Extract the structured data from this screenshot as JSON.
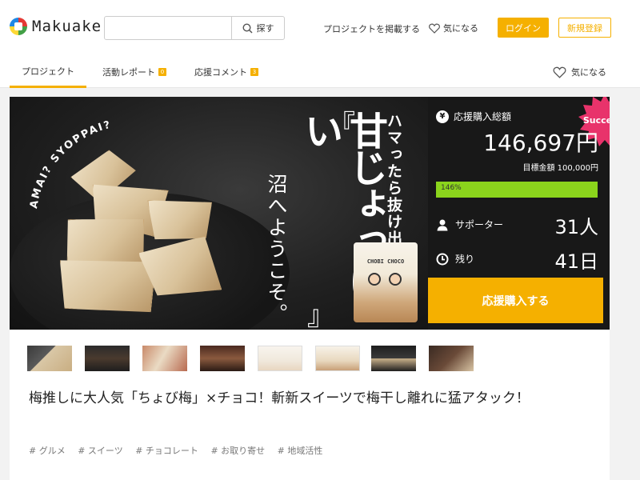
{
  "header": {
    "logo_text": "Makuake",
    "search_placeholder": "",
    "search_button": "探す",
    "post_project": "プロジェクトを掲載する",
    "watchlist": "気になる",
    "login": "ログイン",
    "signup": "新規登録"
  },
  "tabs": {
    "project": "プロジェクト",
    "report": "活動レポート",
    "report_count": "0",
    "comment": "応援コメント",
    "comment_count": "3",
    "watchlist": "気になる"
  },
  "hero": {
    "arc_text": "AMAI? SYOPPAI?",
    "catch_1": "ハマったら抜け出せない。",
    "main_title": "甘じょっぱい",
    "bracket_open": "『",
    "bracket_close": "』",
    "catch_2": "沼へようこそ。",
    "pack_label": "CHOBI CHOCO"
  },
  "stats": {
    "badge": "Success!",
    "total_label": "応援購入総額",
    "total_value": "146,697円",
    "goal": "目標金額 100,000円",
    "progress_percent": 146,
    "progress_label": "146%",
    "supporters_label": "サポーター",
    "supporters_value": "31人",
    "remaining_label": "残り",
    "remaining_value": "41日",
    "buy_button": "応援購入する"
  },
  "colors": {
    "accent": "#f5b000",
    "progress": "#8bd41c",
    "hero_bg": "#181818",
    "success_badge": "#e8336b"
  },
  "project": {
    "title": "梅推しに大人気「ちょび梅」×チョコ！斬新スイーツで梅干し離れに猛アタック！",
    "tags": [
      "# グルメ",
      "# スイーツ",
      "# チョコレート",
      "# お取り寄せ",
      "# 地域活性"
    ]
  }
}
